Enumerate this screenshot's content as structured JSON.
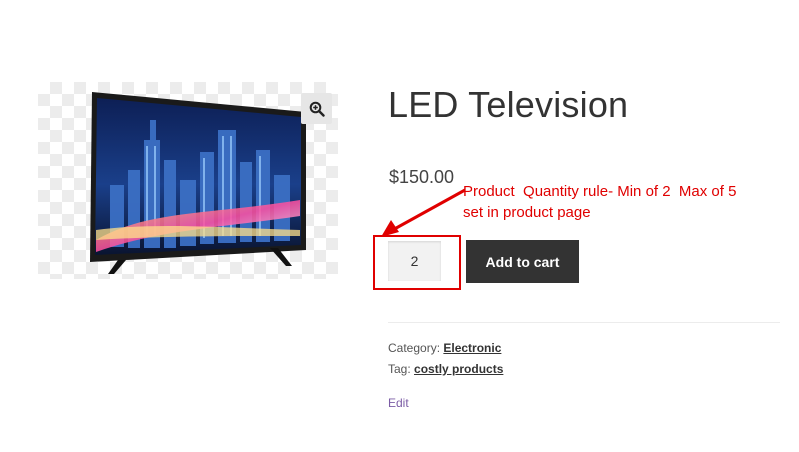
{
  "product": {
    "title": "LED Television",
    "price": "$150.00",
    "image_alt": "LED television showing a night city skyline"
  },
  "gallery": {
    "zoom_icon": "zoom-in-icon"
  },
  "cart": {
    "quantity_value": "2",
    "add_to_cart_label": "Add to cart"
  },
  "annotation": {
    "text": "Product  Quantity rule- Min of 2  Max of 5\nset in product page",
    "color": "#e00000"
  },
  "meta": {
    "category_label": "Category:",
    "category_value": "Electronic",
    "tag_label": "Tag:",
    "tag_value": "costly products"
  },
  "admin": {
    "edit_label": "Edit"
  },
  "colors": {
    "button_bg": "#333333",
    "edit_link": "#7b5ca5",
    "highlight": "#e00000"
  }
}
